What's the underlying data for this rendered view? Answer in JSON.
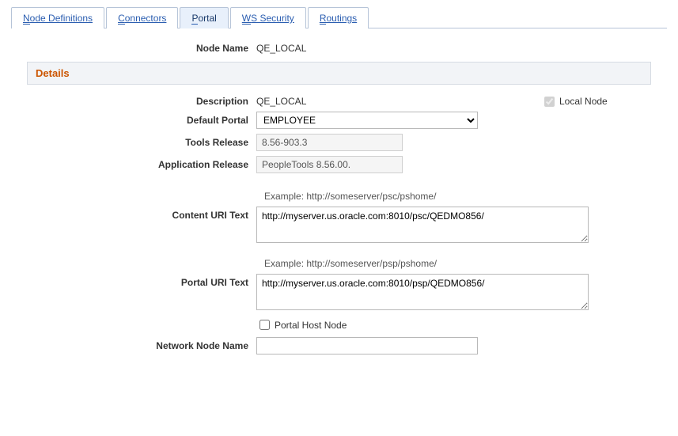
{
  "tabs": {
    "t0": "Node Definitions",
    "t1": "Connectors",
    "t2": "Portal",
    "t3": "WS Security",
    "t4": "Routings"
  },
  "header": {
    "node_name_label": "Node Name",
    "node_name_value": "QE_LOCAL",
    "section_title": "Details"
  },
  "fields": {
    "description_label": "Description",
    "description_value": "QE_LOCAL",
    "local_node_label": "Local Node",
    "default_portal_label": "Default Portal",
    "default_portal_value": "EMPLOYEE",
    "tools_release_label": "Tools Release",
    "tools_release_value": "8.56-903.3",
    "app_release_label": "Application Release",
    "app_release_value": "PeopleTools 8.56.00.",
    "content_uri_hint": "Example: http://someserver/psc/pshome/",
    "content_uri_label": "Content URI Text",
    "content_uri_value": "http://myserver.us.oracle.com:8010/psc/QEDMO856/",
    "portal_uri_hint": "Example: http://someserver/psp/pshome/",
    "portal_uri_label": "Portal URI Text",
    "portal_uri_value": "http://myserver.us.oracle.com:8010/psp/QEDMO856/",
    "portal_host_label": "Portal Host Node",
    "network_node_label": "Network Node Name",
    "network_node_value": ""
  }
}
